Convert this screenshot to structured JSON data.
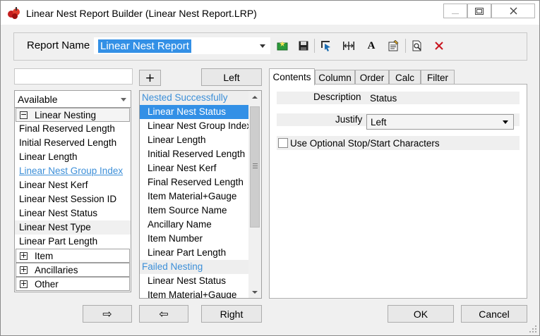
{
  "window": {
    "title": "Linear Nest Report Builder (Linear Nest Report.LRP)",
    "minimize_icon": "minimize-icon",
    "maximize_icon": "maximize-icon",
    "close_icon": "close-icon"
  },
  "toolbar": {
    "report_name_label": "Report Name",
    "report_name_value": "Linear Nest Report",
    "buttons": [
      "new-report-icon",
      "save-icon",
      "select-fields-icon",
      "column-width-icon",
      "font-icon",
      "properties-icon",
      "print-preview-icon",
      "delete-icon"
    ],
    "font_glyph": "A"
  },
  "search": {
    "value": ""
  },
  "add_button_label": "+",
  "left_button_label": "Left",
  "right_button_label": "Right",
  "move_right_glyph": "⇨",
  "move_left_glyph": "⇦",
  "available": {
    "header": "Available",
    "groups": {
      "linear_nesting": {
        "expander": "−",
        "label": "Linear Nesting"
      },
      "item": {
        "expander": "+",
        "label": "Item"
      },
      "ancillaries": {
        "expander": "+",
        "label": "Ancillaries"
      },
      "other": {
        "expander": "+",
        "label": "Other"
      }
    },
    "fields": [
      "Final Reserved Length",
      "Initial Reserved Length",
      "Linear Length",
      "Linear Nest Group Index",
      "Linear Nest Kerf",
      "Linear Nest Session ID",
      "Linear Nest Status",
      "Linear Nest Type",
      "Linear Part Length"
    ]
  },
  "selected": {
    "nested_header": "Nested Successfully",
    "nested_items": [
      "Linear Nest Status",
      "Linear Nest Group Index",
      "Linear Length",
      "Initial Reserved Length",
      "Linear Nest Kerf",
      "Final Reserved Length",
      "Item Material+Gauge",
      "Item Source Name",
      "Ancillary Name",
      "Item Number",
      "Linear Part Length"
    ],
    "failed_header": "Failed Nesting",
    "failed_items": [
      "Linear Nest Status",
      "Item Material+Gauge"
    ]
  },
  "tabs": [
    "Contents",
    "Column",
    "Order",
    "Calc",
    "Filter"
  ],
  "contents": {
    "description_label": "Description",
    "description_value": "Status",
    "justify_label": "Justify",
    "justify_value": "Left",
    "optional_chars_label": "Use Optional Stop/Start Characters"
  },
  "footer": {
    "ok_label": "OK",
    "cancel_label": "Cancel"
  }
}
